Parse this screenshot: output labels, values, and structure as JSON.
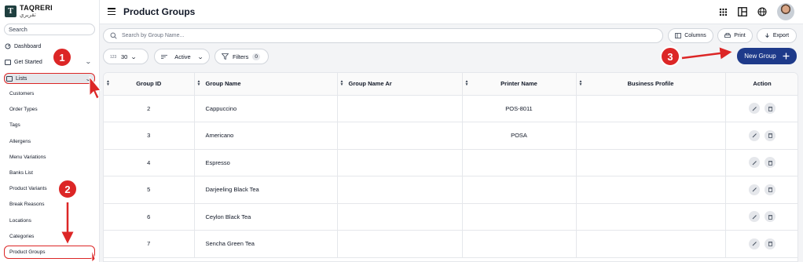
{
  "app": {
    "logo_en": "TAQRERI",
    "logo_ar": "تقريري",
    "logo_letter": "T"
  },
  "sidebar": {
    "search_placeholder": "Search",
    "dashboard": "Dashboard",
    "get_started": "Get Started",
    "lists": "Lists",
    "sub_items": [
      "Customers",
      "Order Types",
      "Tags",
      "Allergens",
      "Menu Variations",
      "Banks List",
      "Product Variants",
      "Break Reasons",
      "Locations",
      "Categories",
      "Product Groups"
    ]
  },
  "header": {
    "title": "Product Groups"
  },
  "toolbar": {
    "search_placeholder": "Search by Group Name...",
    "columns_label": "Columns",
    "print_label": "Print",
    "export_label": "Export",
    "page_size": "30",
    "status_filter": "Active",
    "filters_label": "Filters",
    "filters_count": "0",
    "new_group_label": "New Group"
  },
  "table": {
    "headers": [
      "Group ID",
      "Group Name",
      "Group Name Ar",
      "Printer Name",
      "Business Profile",
      "Action"
    ],
    "rows": [
      {
        "id": "2",
        "name": "Cappuccino",
        "name_ar": "",
        "printer": "POS-8011",
        "profile": ""
      },
      {
        "id": "3",
        "name": "Americano",
        "name_ar": "",
        "printer": "POSA",
        "profile": ""
      },
      {
        "id": "4",
        "name": "Espresso",
        "name_ar": "",
        "printer": "",
        "profile": ""
      },
      {
        "id": "5",
        "name": "Darjeeling Black Tea",
        "name_ar": "",
        "printer": "",
        "profile": ""
      },
      {
        "id": "6",
        "name": "Ceylon Black Tea",
        "name_ar": "",
        "printer": "",
        "profile": ""
      },
      {
        "id": "7",
        "name": "Sencha Green Tea",
        "name_ar": "",
        "printer": "",
        "profile": ""
      }
    ]
  },
  "annotations": {
    "step1": "1",
    "step2": "2",
    "step3": "3",
    "color": "#dc2626"
  },
  "colors": {
    "primary": "#1e3a8a",
    "annotation": "#dc2626"
  }
}
